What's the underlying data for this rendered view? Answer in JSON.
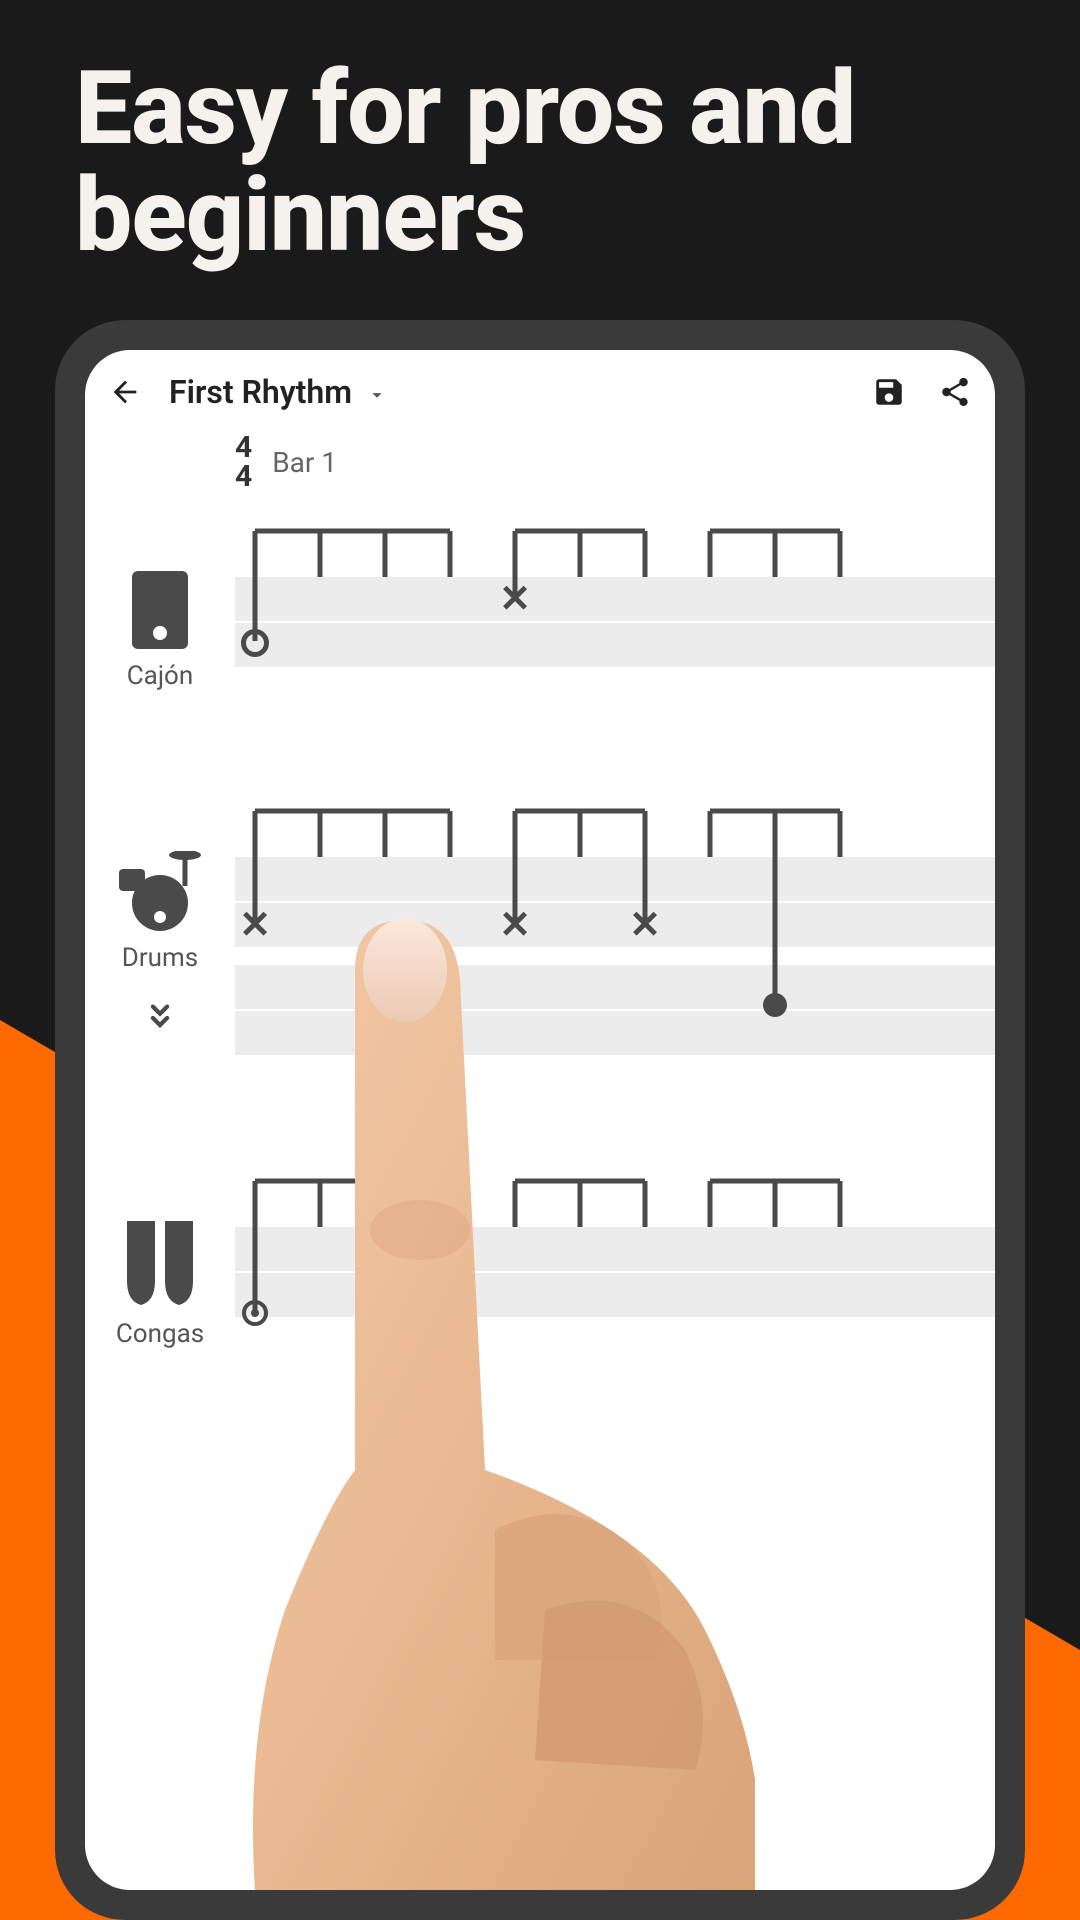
{
  "headline": "Easy for pros and beginners",
  "appbar": {
    "title": "First Rhythm"
  },
  "meta": {
    "time_sig_top": "4",
    "time_sig_bottom": "4",
    "bar_label": "Bar 1"
  },
  "instruments": {
    "cajon": "Cajón",
    "drums": "Drums",
    "congas": "Congas"
  }
}
